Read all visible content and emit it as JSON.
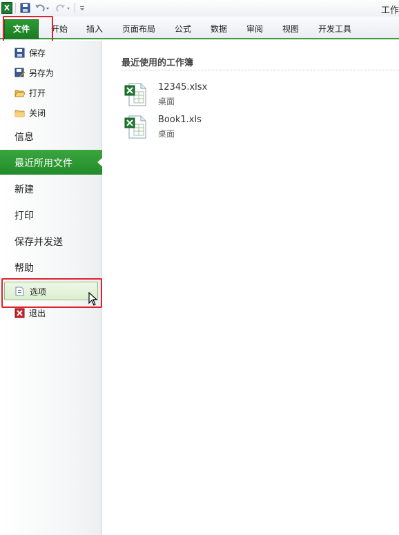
{
  "window": {
    "title_fragment": "工作"
  },
  "ribbon": {
    "tabs": [
      "文件",
      "开始",
      "插入",
      "页面布局",
      "公式",
      "数据",
      "审阅",
      "视图",
      "开发工具"
    ]
  },
  "backstage_nav": {
    "small_items": [
      {
        "label": "保存",
        "icon": "save-icon"
      },
      {
        "label": "另存为",
        "icon": "save-as-icon"
      },
      {
        "label": "打开",
        "icon": "open-folder-icon"
      },
      {
        "label": "关闭",
        "icon": "close-folder-icon"
      }
    ],
    "big_items": [
      "信息",
      "最近所用文件",
      "新建",
      "打印",
      "保存并发送",
      "帮助"
    ],
    "active_item": "最近所用文件",
    "options_label": "选项",
    "exit_label": "退出"
  },
  "recent": {
    "heading": "最近使用的工作簿",
    "files": [
      {
        "name": "12345.xlsx",
        "location": "桌面"
      },
      {
        "name": "Book1.xls",
        "location": "桌面"
      }
    ]
  },
  "colors": {
    "accent_green": "#2a9a32",
    "highlight_red": "#e0202a"
  }
}
